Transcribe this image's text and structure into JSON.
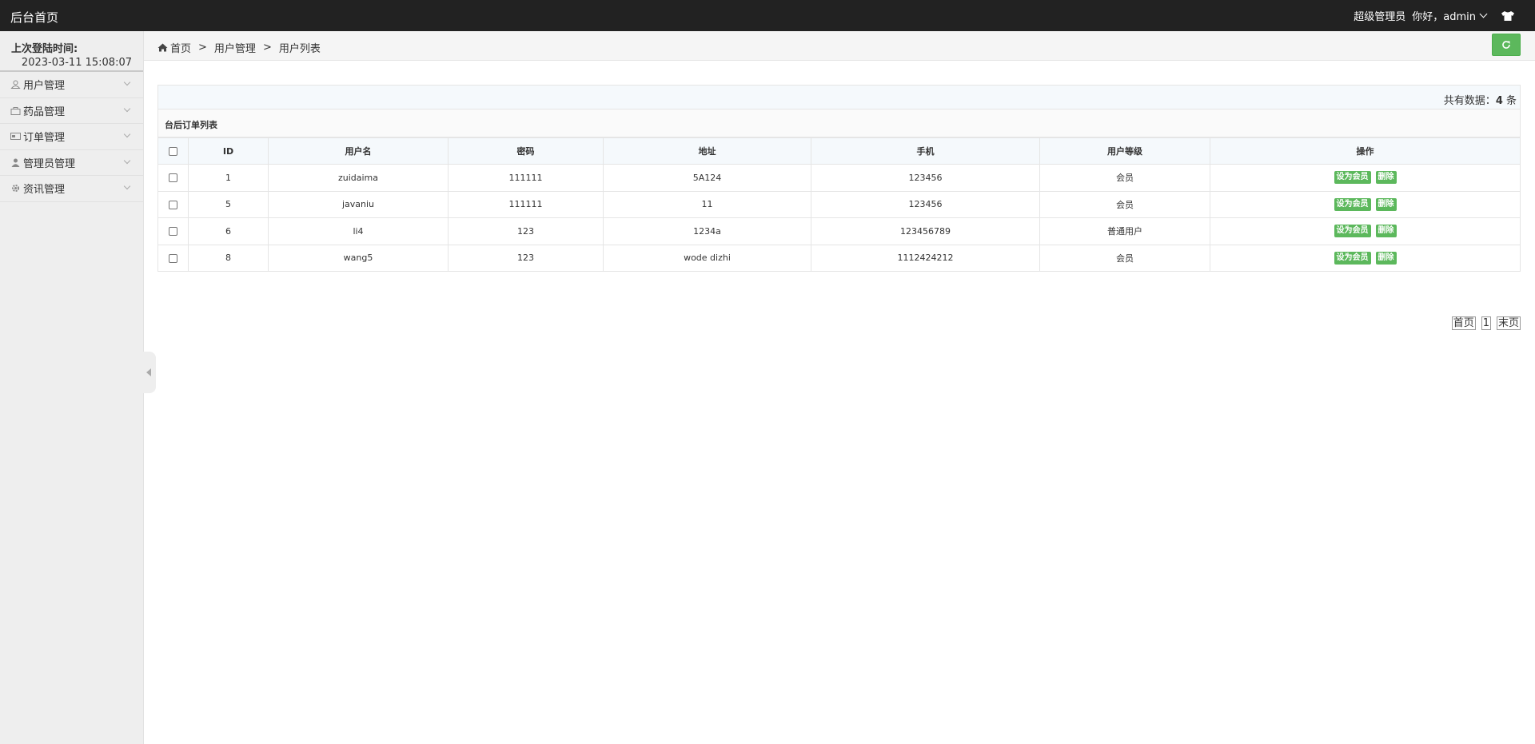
{
  "header": {
    "brand": "后台首页",
    "role": "超级管理员",
    "greeting": "你好，admin"
  },
  "sidebar": {
    "login_label": "上次登陆时间:",
    "login_time": "2023-03-11 15:08:07",
    "items": [
      {
        "label": "用户管理",
        "icon": "user-icon"
      },
      {
        "label": "药品管理",
        "icon": "bag-icon"
      },
      {
        "label": "订单管理",
        "icon": "card-icon"
      },
      {
        "label": "管理员管理",
        "icon": "person-icon"
      },
      {
        "label": "资讯管理",
        "icon": "gear-icon"
      }
    ]
  },
  "breadcrumb": {
    "items": [
      "首页",
      "用户管理",
      "用户列表"
    ],
    "sep": ">"
  },
  "summary": {
    "prefix": "共有数据：",
    "count": "4",
    "suffix": " 条"
  },
  "table": {
    "title": "台后订单列表",
    "columns": [
      "ID",
      "用户名",
      "密码",
      "地址",
      "手机",
      "用户等级",
      "操作"
    ],
    "rows": [
      {
        "id": "1",
        "username": "zuidaima",
        "password": "111111",
        "address": "5A124",
        "phone": "123456",
        "level": "会员"
      },
      {
        "id": "5",
        "username": "javaniu",
        "password": "111111",
        "address": "11",
        "phone": "123456",
        "level": "会员"
      },
      {
        "id": "6",
        "username": "li4",
        "password": "123",
        "address": "1234a",
        "phone": "123456789",
        "level": "普通用户"
      },
      {
        "id": "8",
        "username": "wang5",
        "password": "123",
        "address": "wode dizhi",
        "phone": "1112424212",
        "level": "会员"
      }
    ],
    "action_set_member": "设为会员",
    "action_delete": "删除"
  },
  "pager": {
    "first": "首页",
    "page": "1",
    "last": "末页"
  },
  "colors": {
    "topbar": "#222222",
    "accent_green": "#5cb85c",
    "sidebar_bg": "#eeeeee"
  }
}
